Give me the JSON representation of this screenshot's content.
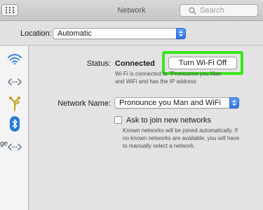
{
  "window": {
    "title": "Network",
    "search_placeholder": "Search"
  },
  "toolbar": {
    "location_label": "Location:",
    "location_value": "Automatic"
  },
  "sidebar": {
    "items": [
      {
        "icon": "wifi-icon"
      },
      {
        "icon": "ethernet-icon"
      },
      {
        "icon": "firewire-icon"
      },
      {
        "icon": "bluetooth-icon"
      },
      {
        "icon": "thunderbolt-bridge-icon"
      }
    ],
    "partial_label": "ge"
  },
  "main": {
    "status_label": "Status:",
    "status_value": "Connected",
    "wifi_button_label": "Turn Wi-Fi Off",
    "status_desc_line1": "Wi-Fi is connected to \"Pronounce you Man",
    "status_desc_line2": "and WiFi and has the IP address",
    "network_name_label": "Network Name:",
    "network_name_value": "Pronounce you Man and WiFi",
    "ask_join_label": "Ask to join new networks",
    "ask_join_desc_line1": "Known networks will be joined automatically. If",
    "ask_join_desc_line2": "no known networks are available, you will have",
    "ask_join_desc_line3": "to manually select a network."
  },
  "colors": {
    "highlight": "#39e61c",
    "accent": "#2f74e8"
  }
}
